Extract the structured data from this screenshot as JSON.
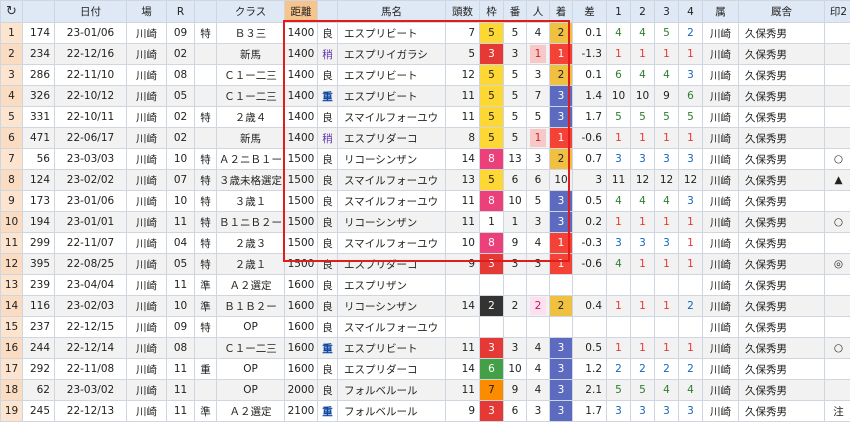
{
  "headers": {
    "refresh": "↻",
    "date": "日付",
    "venue": "場",
    "race": "R",
    "special": "",
    "klass": "クラス",
    "distance": "距離",
    "cond": "",
    "horse": "馬名",
    "count": "頭数",
    "waku": "枠",
    "ban": "番",
    "pop": "人",
    "rank": "着",
    "diff": "差",
    "p1": "1",
    "p2": "2",
    "p3": "3",
    "p4": "4",
    "zoku": "属",
    "trainer": "厩舎",
    "m2": "印2",
    "m5": "印5"
  },
  "rows": [
    {
      "idx": "1",
      "id": "174",
      "date": "23-01/06",
      "venue": "川崎",
      "race": "09",
      "sp": "特",
      "klass": "Ｂ３三",
      "dist": "1400",
      "cond": "良",
      "horse": "エスプリビート",
      "count": "7",
      "waku": "5",
      "ban": "5",
      "pop": "4",
      "rank": "2",
      "diff": "0.1",
      "p1": "4",
      "p2": "4",
      "p3": "5",
      "p4": "2",
      "zoku": "川崎",
      "trainer": "久保秀男",
      "m2": "",
      "m5": "◎"
    },
    {
      "idx": "2",
      "id": "234",
      "date": "22-12/16",
      "venue": "川崎",
      "race": "02",
      "sp": "",
      "klass": "新馬",
      "dist": "1400",
      "cond": "稍",
      "horse": "エスプリイガラシ",
      "count": "5",
      "waku": "3",
      "ban": "3",
      "pop": "1",
      "rank": "1",
      "diff": "-1.3",
      "p1": "1",
      "p2": "1",
      "p3": "1",
      "p4": "1",
      "zoku": "川崎",
      "trainer": "久保秀男",
      "m2": "",
      "m5": ""
    },
    {
      "idx": "3",
      "id": "286",
      "date": "22-11/10",
      "venue": "川崎",
      "race": "08",
      "sp": "",
      "klass": "Ｃ１ー二三",
      "dist": "1400",
      "cond": "良",
      "horse": "エスプリビート",
      "count": "12",
      "waku": "5",
      "ban": "5",
      "pop": "3",
      "rank": "2",
      "diff": "0.1",
      "p1": "6",
      "p2": "4",
      "p3": "4",
      "p4": "3",
      "zoku": "川崎",
      "trainer": "久保秀男",
      "m2": "",
      "m5": ""
    },
    {
      "idx": "4",
      "id": "326",
      "date": "22-10/12",
      "venue": "川崎",
      "race": "05",
      "sp": "",
      "klass": "Ｃ１ー二三",
      "dist": "1400",
      "cond": "重",
      "horse": "エスプリビート",
      "count": "11",
      "waku": "5",
      "ban": "5",
      "pop": "7",
      "rank": "3",
      "diff": "1.4",
      "p1": "10",
      "p2": "10",
      "p3": "9",
      "p4": "6",
      "zoku": "川崎",
      "trainer": "久保秀男",
      "m2": "",
      "m5": ""
    },
    {
      "idx": "5",
      "id": "331",
      "date": "22-10/11",
      "venue": "川崎",
      "race": "02",
      "sp": "特",
      "klass": "２歳４",
      "dist": "1400",
      "cond": "良",
      "horse": "スマイルフォーユウ",
      "count": "11",
      "waku": "5",
      "ban": "5",
      "pop": "5",
      "rank": "3",
      "diff": "1.7",
      "p1": "5",
      "p2": "5",
      "p3": "5",
      "p4": "5",
      "zoku": "川崎",
      "trainer": "久保秀男",
      "m2": "",
      "m5": ""
    },
    {
      "idx": "6",
      "id": "471",
      "date": "22-06/17",
      "venue": "川崎",
      "race": "02",
      "sp": "",
      "klass": "新馬",
      "dist": "1400",
      "cond": "稍",
      "horse": "エスプリダーコ",
      "count": "8",
      "waku": "5",
      "ban": "5",
      "pop": "1",
      "rank": "1",
      "diff": "-0.6",
      "p1": "1",
      "p2": "1",
      "p3": "1",
      "p4": "1",
      "zoku": "川崎",
      "trainer": "久保秀男",
      "m2": "",
      "m5": ""
    },
    {
      "idx": "7",
      "id": "56",
      "date": "23-03/03",
      "venue": "川崎",
      "race": "10",
      "sp": "特",
      "klass": "Ａ２ニＢ１ー",
      "dist": "1500",
      "cond": "良",
      "horse": "リコーシンザン",
      "count": "14",
      "waku": "8",
      "ban": "13",
      "pop": "3",
      "rank": "2",
      "diff": "0.7",
      "p1": "3",
      "p2": "3",
      "p3": "3",
      "p4": "3",
      "zoku": "川崎",
      "trainer": "久保秀男",
      "m2": "○",
      "m5": "○"
    },
    {
      "idx": "8",
      "id": "124",
      "date": "23-02/02",
      "venue": "川崎",
      "race": "07",
      "sp": "特",
      "klass": "３歳未格選定",
      "dist": "1500",
      "cond": "良",
      "horse": "スマイルフォーユウ",
      "count": "13",
      "waku": "5",
      "ban": "6",
      "pop": "6",
      "rank": "10",
      "diff": "3",
      "p1": "11",
      "p2": "12",
      "p3": "12",
      "p4": "12",
      "zoku": "川崎",
      "trainer": "久保秀男",
      "m2": "▲",
      "m5": "▲"
    },
    {
      "idx": "9",
      "id": "173",
      "date": "23-01/06",
      "venue": "川崎",
      "race": "10",
      "sp": "特",
      "klass": "３歳１",
      "dist": "1500",
      "cond": "良",
      "horse": "スマイルフォーユウ",
      "count": "11",
      "waku": "8",
      "ban": "10",
      "pop": "5",
      "rank": "3",
      "diff": "0.5",
      "p1": "4",
      "p2": "4",
      "p3": "4",
      "p4": "3",
      "zoku": "川崎",
      "trainer": "久保秀男",
      "m2": "",
      "m5": ""
    },
    {
      "idx": "10",
      "id": "194",
      "date": "23-01/01",
      "venue": "川崎",
      "race": "11",
      "sp": "特",
      "klass": "Ｂ１ニＢ２ー",
      "dist": "1500",
      "cond": "良",
      "horse": "リコーシンザン",
      "count": "11",
      "waku": "1",
      "ban": "1",
      "pop": "3",
      "rank": "3",
      "diff": "0.2",
      "p1": "1",
      "p2": "1",
      "p3": "1",
      "p4": "1",
      "zoku": "川崎",
      "trainer": "久保秀男",
      "m2": "○",
      "m5": "○"
    },
    {
      "idx": "11",
      "id": "299",
      "date": "22-11/07",
      "venue": "川崎",
      "race": "04",
      "sp": "特",
      "klass": "２歳３",
      "dist": "1500",
      "cond": "良",
      "horse": "スマイルフォーユウ",
      "count": "10",
      "waku": "8",
      "ban": "9",
      "pop": "4",
      "rank": "1",
      "diff": "-0.3",
      "p1": "3",
      "p2": "3",
      "p3": "3",
      "p4": "1",
      "zoku": "川崎",
      "trainer": "久保秀男",
      "m2": "",
      "m5": ""
    },
    {
      "idx": "12",
      "id": "395",
      "date": "22-08/25",
      "venue": "川崎",
      "race": "05",
      "sp": "特",
      "klass": "２歳１",
      "dist": "1500",
      "cond": "良",
      "horse": "エスプリダーコ",
      "count": "9",
      "waku": "3",
      "ban": "3",
      "pop": "3",
      "rank": "1",
      "diff": "-0.6",
      "p1": "4",
      "p2": "1",
      "p3": "1",
      "p4": "1",
      "zoku": "川崎",
      "trainer": "久保秀男",
      "m2": "◎",
      "m5": "◎"
    },
    {
      "idx": "13",
      "id": "239",
      "date": "23-04/04",
      "venue": "川崎",
      "race": "11",
      "sp": "準",
      "klass": "Ａ２選定",
      "dist": "1600",
      "cond": "良",
      "horse": "エスプリザン",
      "count": "",
      "waku": "",
      "ban": "",
      "pop": "",
      "rank": "",
      "diff": "",
      "p1": "",
      "p2": "",
      "p3": "",
      "p4": "",
      "zoku": "川崎",
      "trainer": "久保秀男",
      "m2": "",
      "m5": ""
    },
    {
      "idx": "14",
      "id": "116",
      "date": "23-02/03",
      "venue": "川崎",
      "race": "10",
      "sp": "準",
      "klass": "Ｂ１Ｂ２ー",
      "dist": "1600",
      "cond": "良",
      "horse": "リコーシンザン",
      "count": "14",
      "waku": "2",
      "ban": "2",
      "pop": "2",
      "rank": "2",
      "diff": "0.4",
      "p1": "1",
      "p2": "1",
      "p3": "1",
      "p4": "2",
      "zoku": "川崎",
      "trainer": "久保秀男",
      "m2": "",
      "m5": ""
    },
    {
      "idx": "15",
      "id": "237",
      "date": "22-12/15",
      "venue": "川崎",
      "race": "09",
      "sp": "特",
      "klass": "OP",
      "dist": "1600",
      "cond": "良",
      "horse": "スマイルフォーユウ",
      "count": "",
      "waku": "",
      "ban": "",
      "pop": "",
      "rank": "",
      "diff": "",
      "p1": "",
      "p2": "",
      "p3": "",
      "p4": "",
      "zoku": "川崎",
      "trainer": "久保秀男",
      "m2": "",
      "m5": ""
    },
    {
      "idx": "16",
      "id": "244",
      "date": "22-12/14",
      "venue": "川崎",
      "race": "08",
      "sp": "",
      "klass": "Ｃ１ー二三",
      "dist": "1600",
      "cond": "重",
      "horse": "エスプリビート",
      "count": "11",
      "waku": "3",
      "ban": "3",
      "pop": "4",
      "rank": "3",
      "diff": "0.5",
      "p1": "1",
      "p2": "1",
      "p3": "1",
      "p4": "1",
      "zoku": "川崎",
      "trainer": "久保秀男",
      "m2": "○",
      "m5": "○"
    },
    {
      "idx": "17",
      "id": "292",
      "date": "22-11/08",
      "venue": "川崎",
      "race": "11",
      "sp": "重",
      "klass": "OP",
      "dist": "1600",
      "cond": "良",
      "horse": "エスプリダーコ",
      "count": "14",
      "waku": "6",
      "ban": "10",
      "pop": "4",
      "rank": "3",
      "diff": "1.2",
      "p1": "2",
      "p2": "2",
      "p3": "2",
      "p4": "2",
      "zoku": "川崎",
      "trainer": "久保秀男",
      "m2": "",
      "m5": ""
    },
    {
      "idx": "18",
      "id": "62",
      "date": "23-03/02",
      "venue": "川崎",
      "race": "11",
      "sp": "",
      "klass": "OP",
      "dist": "2000",
      "cond": "良",
      "horse": "フォルベルール",
      "count": "11",
      "waku": "7",
      "ban": "9",
      "pop": "4",
      "rank": "3",
      "diff": "2.1",
      "p1": "5",
      "p2": "5",
      "p3": "4",
      "p4": "4",
      "zoku": "川崎",
      "trainer": "久保秀男",
      "m2": "",
      "m5": "△"
    },
    {
      "idx": "19",
      "id": "245",
      "date": "22-12/13",
      "venue": "川崎",
      "race": "11",
      "sp": "準",
      "klass": "Ａ２選定",
      "dist": "2100",
      "cond": "重",
      "horse": "フォルベルール",
      "count": "9",
      "waku": "3",
      "ban": "6",
      "pop": "3",
      "rank": "3",
      "diff": "1.7",
      "p1": "3",
      "p2": "3",
      "p3": "3",
      "p4": "3",
      "zoku": "川崎",
      "trainer": "久保秀男",
      "m2": "注",
      "m5": ""
    }
  ],
  "colors": {
    "waku": {
      "1": "#ffffff",
      "2": "#333333",
      "3": "#e53935",
      "4": "#1e88e5",
      "5": "#fdd835",
      "6": "#43a047",
      "7": "#fb8c00",
      "8": "#ec407a"
    },
    "rank": {
      "1": "#f44336",
      "2": "#f0c040",
      "3": "#5c6bc0"
    },
    "highlight": "#e21b1b"
  }
}
